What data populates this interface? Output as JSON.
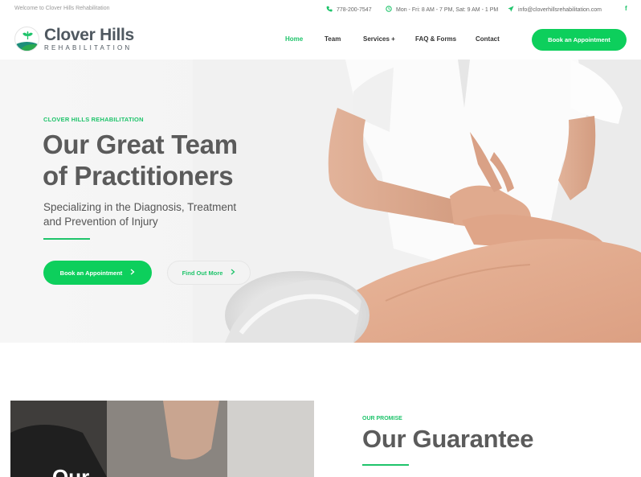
{
  "topbar": {
    "welcome": "Welcome to Clover Hills Rehabilitation",
    "phone": "778-200-7547",
    "hours": "Mon - Fri: 8 AM - 7 PM, Sat: 9 AM - 1 PM",
    "email": "info@cloverhillsrehabilitation.com",
    "social_icon": "f"
  },
  "header": {
    "logo_title": "Clover Hills",
    "logo_subtitle": "REHABILITATION",
    "nav": [
      "Home",
      "Team",
      "Services +",
      "FAQ & Forms",
      "Contact"
    ],
    "active_nav": "Home",
    "cta": "Book an Appointment"
  },
  "hero": {
    "eyebrow": "CLOVER HILLS REHABILITATION",
    "title_line1": "Our Great Team",
    "title_line2": "of Practitioners",
    "subtitle_line1": "Specializing in the Diagnosis, Treatment",
    "subtitle_line2": "and Prevention of Injury",
    "primary_button": "Book an Appointment",
    "secondary_button": "Find Out More"
  },
  "promise": {
    "image_text": "Our",
    "eyebrow": "OUR PROMISE",
    "title": "Our Guarantee"
  },
  "colors": {
    "accent": "#1fc46b",
    "button": "#0dcf5c",
    "heading": "#5b5b5b"
  },
  "icons": {
    "phone": "phone-icon",
    "clock": "clock-icon",
    "email": "paper-plane-icon",
    "social": "facebook-icon",
    "chevron": "chevron-right-icon"
  }
}
